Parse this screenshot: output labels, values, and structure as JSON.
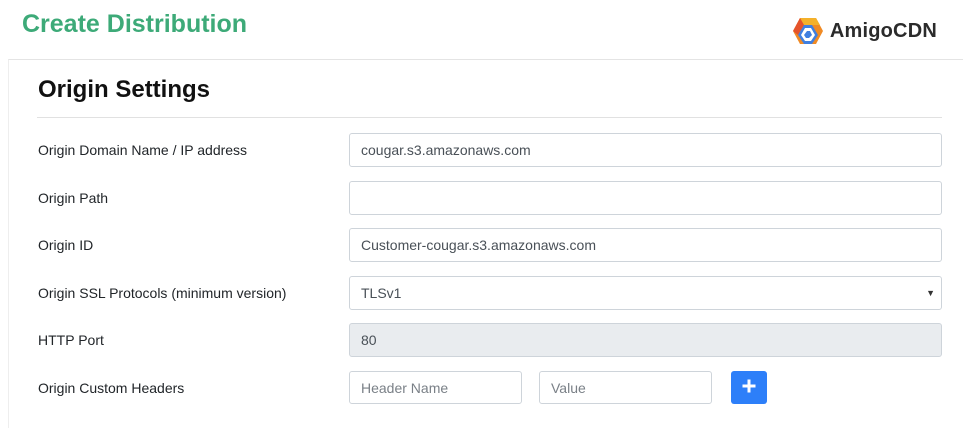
{
  "header": {
    "title": "Create Distribution",
    "brand_name": "AmigoCDN",
    "brand_logo_icon": "amigocdn-logo-icon",
    "title_color": "#3daa78"
  },
  "section": {
    "title": "Origin Settings"
  },
  "form": {
    "origin_domain": {
      "label": "Origin Domain Name / IP address",
      "value": "cougar.s3.amazonaws.com"
    },
    "origin_path": {
      "label": "Origin Path",
      "value": ""
    },
    "origin_id": {
      "label": "Origin ID",
      "value": "Customer-cougar.s3.amazonaws.com"
    },
    "ssl_protocols": {
      "label": "Origin SSL Protocols (minimum version)",
      "selected": "TLSv1",
      "caret_icon": "caret-down-icon"
    },
    "http_port": {
      "label": "HTTP Port",
      "value": "80",
      "disabled": true
    },
    "custom_headers": {
      "label": "Origin Custom Headers",
      "header_name_placeholder": "Header Name",
      "value_placeholder": "Value",
      "add_icon": "plus-icon",
      "add_button_color": "#2d7ff9"
    }
  }
}
